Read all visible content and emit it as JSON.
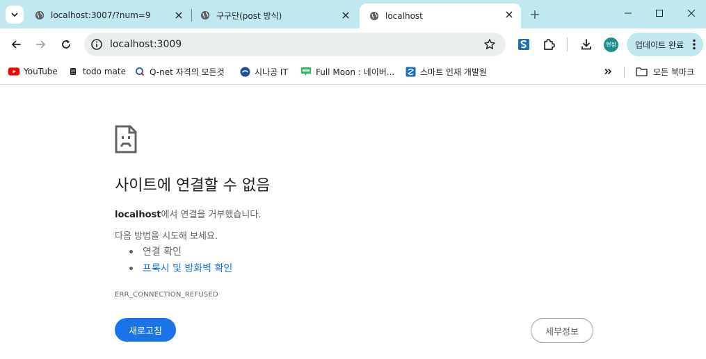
{
  "tabs": [
    {
      "title": "localhost:3007/?num=9",
      "active": false
    },
    {
      "title": "구구단(post 방식)",
      "active": false
    },
    {
      "title": "localhost",
      "active": true
    }
  ],
  "toolbar": {
    "url": "localhost:3009",
    "profile_initials": "현정",
    "update_label": "업데이트 완료"
  },
  "bookmarks": {
    "items": [
      {
        "label": "YouTube",
        "icon": "youtube-icon"
      },
      {
        "label": "todo mate",
        "icon": "todomate-icon"
      },
      {
        "label": "Q-net 자격의 모든것",
        "icon": "qnet-icon"
      },
      {
        "label": "시나공 IT",
        "icon": "sinagong-icon"
      },
      {
        "label": "Full Moon : 네이버...",
        "icon": "naver-blog-icon"
      },
      {
        "label": "스마트 인재 개발원",
        "icon": "smart-icon"
      }
    ],
    "all_bookmarks_label": "모든 북마크"
  },
  "error_page": {
    "title": "사이트에 연결할 수 없음",
    "host": "localhost",
    "description_suffix": "에서 연결을 거부했습니다.",
    "try_text": "다음 방법을 시도해 보세요.",
    "suggestions": [
      "연결 확인",
      "프록시 및 방화벽 확인"
    ],
    "error_code": "ERR_CONNECTION_REFUSED",
    "reload_label": "새로고침",
    "details_label": "세부정보"
  },
  "colors": {
    "tabstrip": "#bfe8f1",
    "accent_blue": "#1a73e8",
    "profile": "#1b8f8a"
  }
}
